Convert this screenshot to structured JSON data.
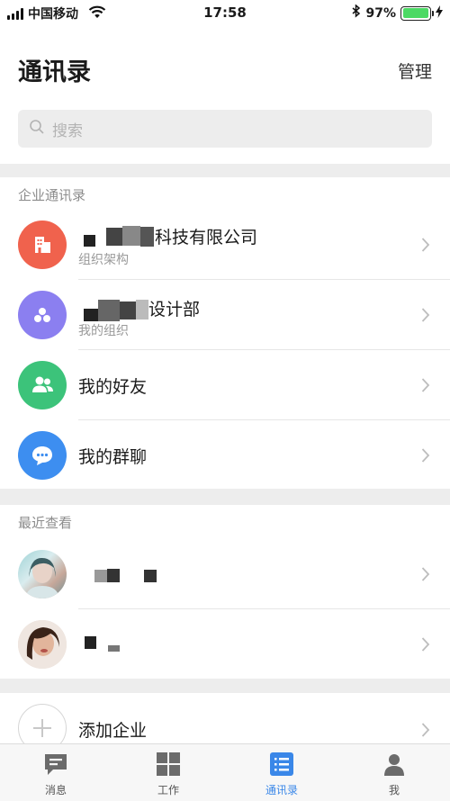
{
  "status_bar": {
    "carrier": "中国移动",
    "time": "17:58",
    "battery": "97%",
    "battery_level": 0.97
  },
  "header": {
    "title": "通讯录",
    "manage_label": "管理"
  },
  "search": {
    "placeholder": "搜索"
  },
  "enterprise": {
    "section_label": "企业通讯录",
    "items": [
      {
        "title": "科技有限公司",
        "subtitle": "组织架构",
        "icon": "building-icon",
        "color": "#f0624d"
      },
      {
        "title": "设计部",
        "subtitle": "我的组织",
        "icon": "org-nodes-icon",
        "color": "#8b7ff0"
      },
      {
        "title": "我的好友",
        "icon": "friends-icon",
        "color": "#3cc37a"
      },
      {
        "title": "我的群聊",
        "icon": "group-chat-icon",
        "color": "#3d8ef0"
      }
    ]
  },
  "recent": {
    "section_label": "最近查看"
  },
  "add_enterprise": {
    "label": "添加企业"
  },
  "tabbar": {
    "tabs": [
      {
        "label": "消息",
        "icon": "message-icon"
      },
      {
        "label": "工作",
        "icon": "grid-icon"
      },
      {
        "label": "通讯录",
        "icon": "contacts-list-icon",
        "active": true
      },
      {
        "label": "我",
        "icon": "person-icon"
      }
    ]
  },
  "colors": {
    "accent": "#3a87e8",
    "background": "#ededed"
  }
}
